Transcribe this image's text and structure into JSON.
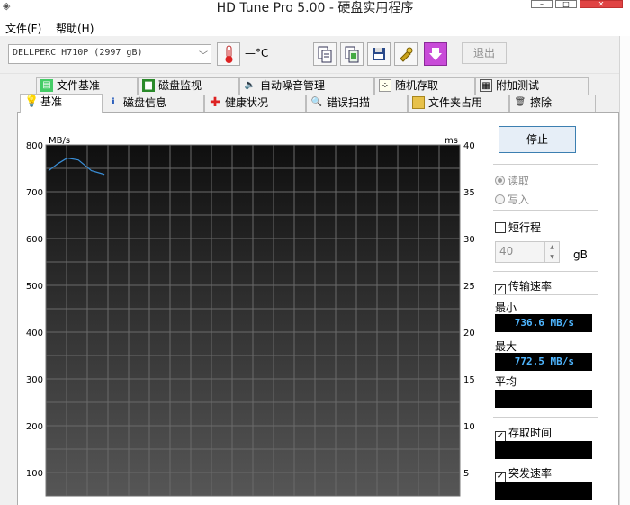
{
  "window": {
    "title": "HD Tune Pro 5.00 - 硬盘实用程序"
  },
  "menu": {
    "file": "文件(F)",
    "help": "帮助(H)"
  },
  "toolbar": {
    "drive": "DELLPERC H710P (2997 gB)",
    "temperature": "—°C",
    "exit_label": "退出"
  },
  "tabs": {
    "row1": [
      "文件基准",
      "磁盘监视",
      "自动噪音管理",
      "随机存取",
      "附加测试"
    ],
    "row2": [
      "基准",
      "磁盘信息",
      "健康状况",
      "错误扫描",
      "文件夹占用",
      "擦除"
    ],
    "active": "基准"
  },
  "chart_data": {
    "type": "line",
    "y_left_unit": "MB/s",
    "y_right_unit": "ms",
    "y_left_ticks": [
      100,
      200,
      300,
      400,
      500,
      600,
      700,
      800
    ],
    "y_right_ticks": [
      5,
      10,
      15,
      20,
      25,
      30,
      35,
      40
    ],
    "ylim_left": [
      0,
      800
    ],
    "ylim_right": [
      0,
      40
    ],
    "grid": true,
    "series": [
      {
        "unit": "MB/s",
        "color": "#3a8fd8",
        "x": [
          0,
          0.5,
          1,
          1.6,
          2.3,
          3
        ],
        "values": [
          745,
          760,
          772,
          768,
          745,
          737
        ]
      }
    ]
  },
  "controls": {
    "stop_label": "停止",
    "read_label": "读取",
    "write_label": "写入",
    "short_stroke_label": "短行程",
    "short_stroke_value": "40",
    "short_stroke_unit": "gB",
    "transfer_rate_label": "传输速率",
    "min_label": "最小",
    "min_value": "736.6 MB/s",
    "max_label": "最大",
    "max_value": "772.5 MB/s",
    "avg_label": "平均",
    "access_time_label": "存取时间",
    "burst_label": "突发速率"
  }
}
